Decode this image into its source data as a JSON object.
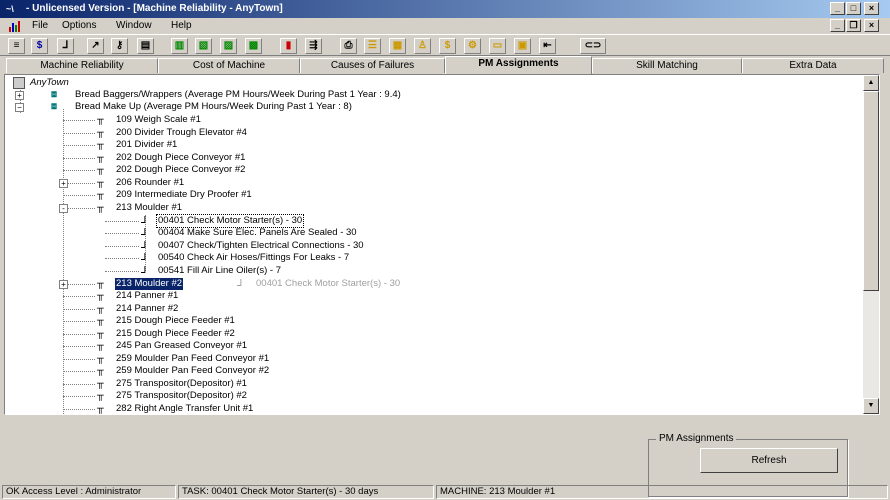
{
  "window": {
    "title": "- Unlicensed Version - [Machine Reliability - AnyTown]"
  },
  "menu": {
    "items": [
      "File",
      "Options",
      "Window",
      "Help"
    ]
  },
  "tabs": [
    {
      "label": "Machine Reliability"
    },
    {
      "label": "Cost of Machine"
    },
    {
      "label": "Causes of Failures"
    },
    {
      "label": "PM Assignments",
      "active": true
    },
    {
      "label": "Skill Matching"
    },
    {
      "label": "Extra Data"
    }
  ],
  "tree": {
    "root": "AnyTown",
    "groups": [
      {
        "label": "Bread Baggers/Wrappers (Average PM Hours/Week During Past 1 Year : 9.4)",
        "expanded": false
      },
      {
        "label": "Bread Make Up (Average PM Hours/Week During Past 1 Year : 8)",
        "expanded": true
      }
    ],
    "machines": [
      {
        "label": "109 Weigh Scale #1"
      },
      {
        "label": "200 Divider Trough Elevator #4"
      },
      {
        "label": "201 Divider #1"
      },
      {
        "label": "202 Dough Piece Conveyor #1"
      },
      {
        "label": "202 Dough Piece Conveyor #2"
      },
      {
        "label": "206 Rounder #1",
        "expander": "+"
      },
      {
        "label": "209 Intermediate Dry Proofer #1"
      },
      {
        "label": "213 Moulder #1",
        "expander": "-"
      }
    ],
    "tasks": [
      {
        "label": "00401 Check Motor Starter(s) - 30",
        "focused": true
      },
      {
        "label": "00404 Make Sure Elec. Panels Are Sealed - 30"
      },
      {
        "label": "00407 Check/Tighten Electrical Connections - 30"
      },
      {
        "label": "00540 Check Air Hoses/Fittings For Leaks - 7"
      },
      {
        "label": "00541 Fill Air Line Oiler(s) - 7"
      }
    ],
    "selected_machine": {
      "label": "213 Moulder #2"
    },
    "drag_ghost": {
      "label": "00401 Check Motor Starter(s) - 30"
    },
    "machines_after": [
      {
        "label": "214 Panner #1"
      },
      {
        "label": "214 Panner #2"
      },
      {
        "label": "215 Dough Piece Feeder #1"
      },
      {
        "label": "215 Dough Piece Feeder #2"
      },
      {
        "label": "245 Pan Greased Conveyor #1"
      },
      {
        "label": "259 Moulder Pan Feed Conveyor #1"
      },
      {
        "label": "259 Moulder Pan Feed Conveyor #2"
      },
      {
        "label": "275 Transpositor(Depositor) #1"
      },
      {
        "label": "275 Transpositor(Depositor) #2"
      },
      {
        "label": "282 Right Angle Transfer Unit #1"
      }
    ]
  },
  "pm_group": {
    "title": "PM Assignments",
    "refresh_label": "Refresh"
  },
  "status": {
    "access": "OK Access Level : Administrator",
    "task": "TASK: 00401 Check Motor Starter(s) - 30 days",
    "machine": "MACHINE: 213 Moulder #1"
  },
  "colors": {
    "selection": "#0a246a",
    "face": "#d4d0c8",
    "title_start": "#0a246a",
    "title_end": "#a6caf0"
  }
}
